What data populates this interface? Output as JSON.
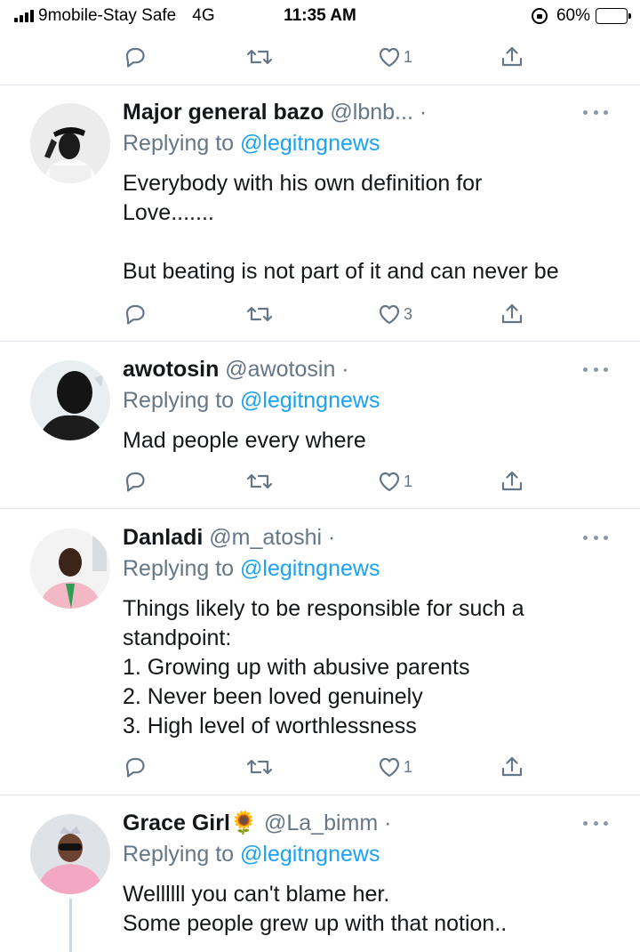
{
  "status_bar": {
    "carrier": "9mobile-Stay Safe",
    "network": "4G",
    "time": "11:35 AM",
    "battery": "60%",
    "battery_level": 0.6,
    "battery_color": "#f7c92c"
  },
  "top_actions": {
    "like_count": "1"
  },
  "tweets": [
    {
      "name": "Major general bazo",
      "handle": "@lbnb... ·",
      "replying_prefix": "Replying to",
      "replying_to": "@legitngnews",
      "text": "Everybody with his own definition for\nLove.......\n\nBut beating is not part of it and can never be",
      "like_count": "3"
    },
    {
      "name": "awotosin",
      "handle": "@awotosin ·",
      "replying_prefix": "Replying to",
      "replying_to": "@legitngnews",
      "text": "Mad people every where",
      "like_count": "1"
    },
    {
      "name": "Danladi",
      "handle": "@m_atoshi ·",
      "replying_prefix": "Replying to",
      "replying_to": "@legitngnews",
      "text": "Things likely to be responsible for such a\nstandpoint:\n1. Growing up with abusive parents\n2. Never been loved genuinely\n3. High level of worthlessness",
      "like_count": "1"
    },
    {
      "name": "Grace Girl🌻",
      "handle": "@La_bimm ·",
      "replying_prefix": "Replying to",
      "replying_to": "@legitngnews",
      "text": "Wellllll you can't blame her.\nSome people grew up with that notion.."
    }
  ],
  "icons": {
    "reply": "reply-icon",
    "retweet": "retweet-icon",
    "like": "heart-icon",
    "share": "share-icon",
    "more": "more-icon"
  },
  "colors": {
    "link": "#1da1f2",
    "secondary": "#657786",
    "divider": "#e1e8ed"
  }
}
